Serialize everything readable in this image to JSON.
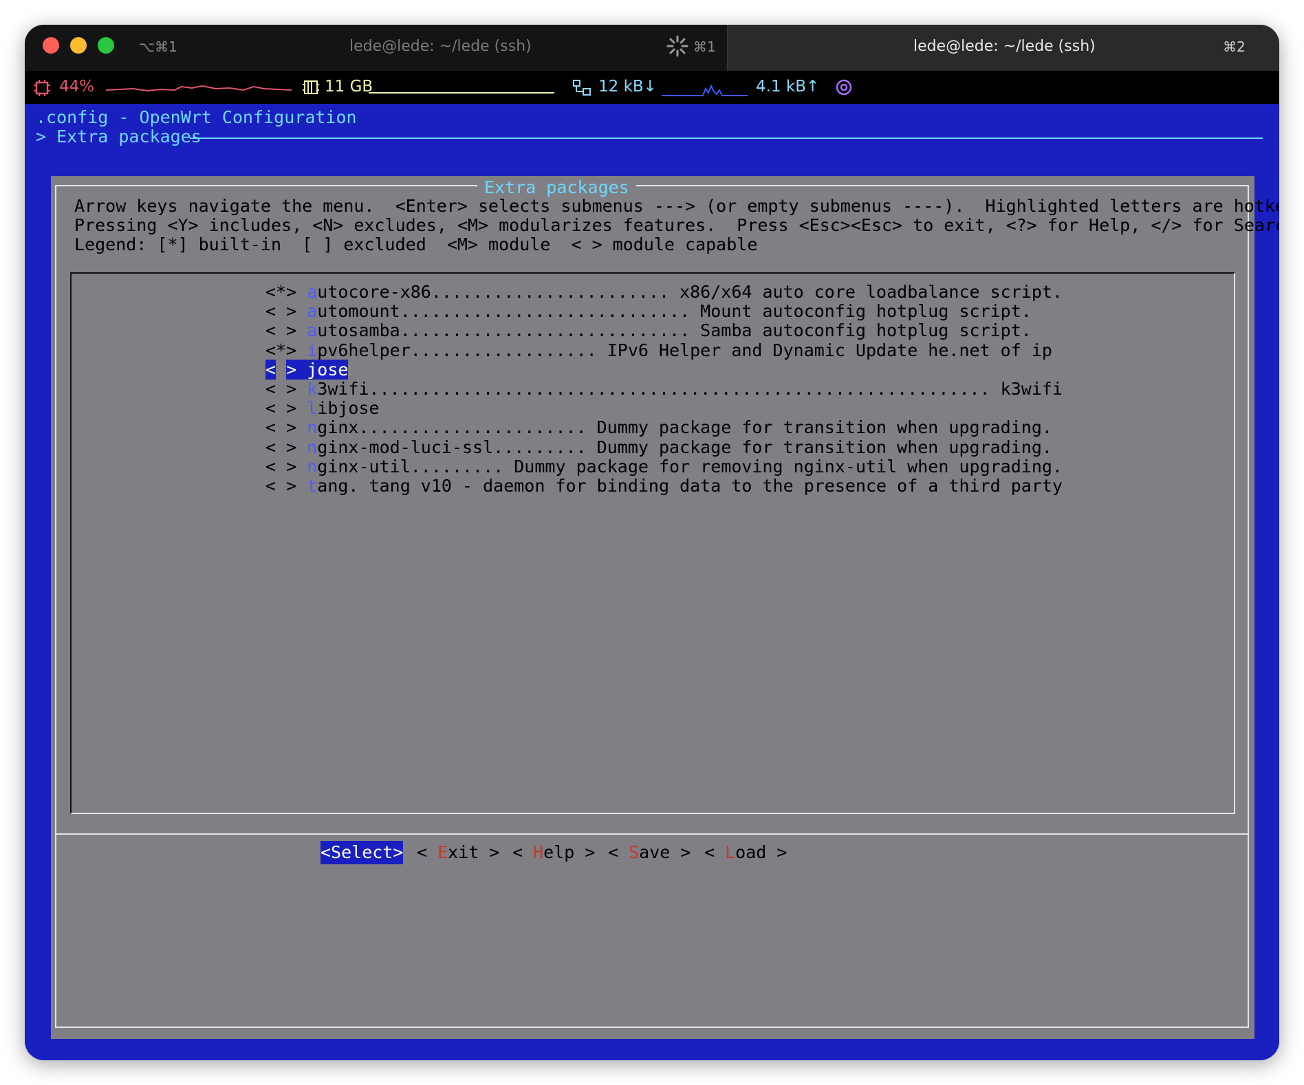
{
  "window": {
    "tabs": [
      {
        "title": "lede@lede: ~/lede (ssh)",
        "shortcut_left": "⌥⌘1",
        "shortcut_right": "⌘1"
      },
      {
        "title": "lede@lede: ~/lede (ssh)",
        "shortcut_right": "⌘2"
      }
    ]
  },
  "status": {
    "cpu": "44%",
    "mem": "11 GB",
    "net_down": "12 kB↓",
    "net_up": "4.1 kB↑",
    "cpu_icon": "cpu-chip-icon",
    "mem_icon": "memory-icon",
    "net_icon": "network-icon",
    "target_icon": "target-icon"
  },
  "terminal": {
    "header_line1": ".config - OpenWrt Configuration",
    "header_line2": "> Extra packages",
    "dialog_title": "Extra packages",
    "help_lines": [
      "Arrow keys navigate the menu.  <Enter> selects submenus ---> (or empty submenus ----).  Highlighted letters are hotkeys.",
      "Pressing <Y> includes, <N> excludes, <M> modularizes features.  Press <Esc><Esc> to exit, <?> for Help, </> for Search.",
      "Legend: [*] built-in  [ ] excluded  <M> module  < > module capable"
    ],
    "menu_items": [
      {
        "prefix": "<*> ",
        "hotkey": "a",
        "rest": "utocore-x86....................... x86/x64 auto core loadbalance script.",
        "selected": false
      },
      {
        "prefix": "< > ",
        "hotkey": "a",
        "rest": "utomount............................ Mount autoconfig hotplug script.",
        "selected": false
      },
      {
        "prefix": "< > ",
        "hotkey": "a",
        "rest": "utosamba............................ Samba autoconfig hotplug script.",
        "selected": false
      },
      {
        "prefix": "<*> ",
        "hotkey": "i",
        "rest": "pv6helper.................. IPv6 Helper and Dynamic Update he.net of ip",
        "selected": false
      },
      {
        "prefix": "< > ",
        "hotkey": "j",
        "rest": "ose",
        "selected": true
      },
      {
        "prefix": "< > ",
        "hotkey": "k",
        "rest": "3wifi............................................................ k3wifi",
        "selected": false
      },
      {
        "prefix": "< > ",
        "hotkey": "l",
        "rest": "ibjose",
        "selected": false
      },
      {
        "prefix": "< > ",
        "hotkey": "n",
        "rest": "ginx...................... Dummy package for transition when upgrading.",
        "selected": false
      },
      {
        "prefix": "< > ",
        "hotkey": "n",
        "rest": "ginx-mod-luci-ssl......... Dummy package for transition when upgrading.",
        "selected": false
      },
      {
        "prefix": "< > ",
        "hotkey": "n",
        "rest": "ginx-util......... Dummy package for removing nginx-util when upgrading.",
        "selected": false
      },
      {
        "prefix": "< > ",
        "hotkey": "t",
        "rest": "ang. tang v10 - daemon for binding data to the presence of a third party",
        "selected": false
      }
    ],
    "buttons": [
      {
        "label": "<Select>",
        "selected": true
      },
      {
        "open": "< ",
        "hotkey": "E",
        "rest": "xit",
        "close": " >",
        "selected": false
      },
      {
        "open": "< ",
        "hotkey": "H",
        "rest": "elp",
        "close": " >",
        "selected": false
      },
      {
        "open": "< ",
        "hotkey": "S",
        "rest": "ave",
        "close": " >",
        "selected": false
      },
      {
        "open": "< ",
        "hotkey": "L",
        "rest": "oad",
        "close": " >",
        "selected": false
      }
    ]
  },
  "colors": {
    "terminal_bg": "#1a20c0",
    "header_fg": "#6fd8ff",
    "dialog_bg": "#7f7f84",
    "hotkey": "#4f5cff",
    "button_hotkey": "#c63a2e",
    "highlight_bg": "#1a20c0"
  }
}
